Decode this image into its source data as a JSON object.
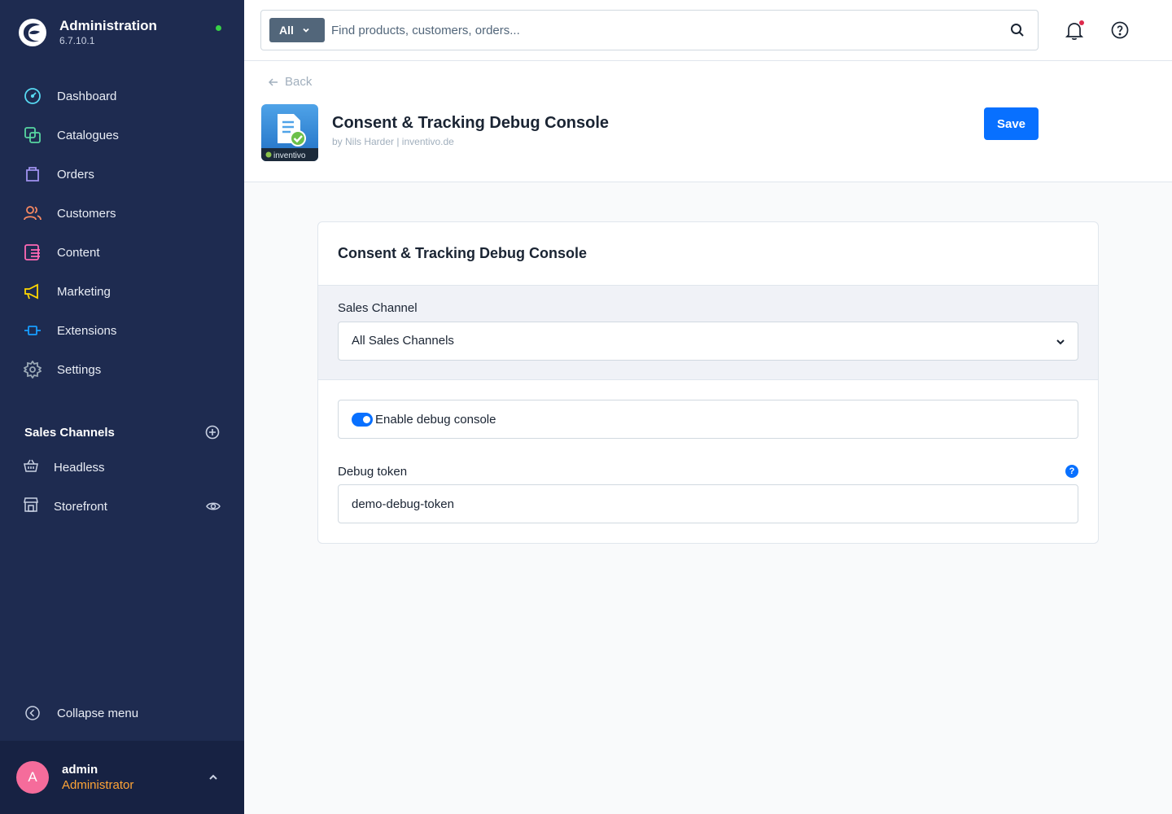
{
  "brand": {
    "title": "Administration",
    "version": "6.7.10.1"
  },
  "nav": {
    "items": [
      {
        "label": "Dashboard",
        "icon": "dashboard-icon",
        "color": "#57d9f2"
      },
      {
        "label": "Catalogues",
        "icon": "catalogue-icon",
        "color": "#57d6a1"
      },
      {
        "label": "Orders",
        "icon": "orders-icon",
        "color": "#a092f0"
      },
      {
        "label": "Customers",
        "icon": "customers-icon",
        "color": "#f88962"
      },
      {
        "label": "Content",
        "icon": "content-icon",
        "color": "#ff68b4"
      },
      {
        "label": "Marketing",
        "icon": "marketing-icon",
        "color": "#ffd700"
      },
      {
        "label": "Extensions",
        "icon": "extensions-icon",
        "color": "#189eff"
      },
      {
        "label": "Settings",
        "icon": "settings-icon",
        "color": "#9aa8b5"
      }
    ]
  },
  "sales_channels": {
    "title": "Sales Channels",
    "items": [
      {
        "label": "Headless",
        "icon": "basket-icon"
      },
      {
        "label": "Storefront",
        "icon": "storefront-icon"
      }
    ]
  },
  "collapse": {
    "label": "Collapse menu"
  },
  "user": {
    "initial": "A",
    "name": "admin",
    "role": "Administrator"
  },
  "search": {
    "type_label": "All",
    "placeholder": "Find products, customers, orders..."
  },
  "smartbar": {
    "back_label": "Back",
    "title": "Consent & Tracking Debug Console",
    "subtitle": "by Nils Harder | inventivo.de",
    "save_label": "Save",
    "icon_brand_text": "inventivo"
  },
  "card": {
    "title": "Consent & Tracking Debug Console",
    "sales_channel": {
      "label": "Sales Channel",
      "value": "All Sales Channels"
    },
    "debug_toggle": {
      "label": "Enable debug console",
      "enabled": true
    },
    "debug_token": {
      "label": "Debug token",
      "value": "demo-debug-token",
      "help": "?"
    }
  },
  "colors": {
    "sidebar": "#1e2b50",
    "primary": "#0870ff",
    "status_online": "#37d046",
    "role": "#ffa436"
  }
}
